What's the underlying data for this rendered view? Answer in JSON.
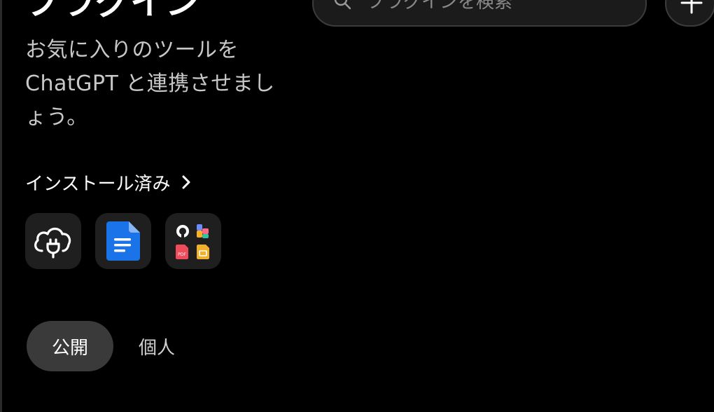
{
  "header": {
    "title": "プラグイン",
    "subtitle": "お気に入りのツールを ChatGPT と連携させましょう。"
  },
  "search": {
    "placeholder": "プラグインを検索",
    "icon": "search-icon"
  },
  "add_button": {
    "icon": "plus-icon"
  },
  "installed": {
    "label": "インストール済み",
    "icon": "chevron-right-icon",
    "plugins": [
      {
        "icon": "cloud-plug-icon"
      },
      {
        "icon": "document-icon",
        "color": "#1a73e8"
      },
      {
        "icon": "multi-app-icon"
      }
    ]
  },
  "tabs": [
    {
      "label": "公開",
      "selected": true
    },
    {
      "label": "個人",
      "selected": false
    }
  ],
  "colors": {
    "background": "#000000",
    "tile": "#1f1f1f",
    "selected_tab": "#3a3a3a",
    "accent_blue": "#1a73e8"
  }
}
